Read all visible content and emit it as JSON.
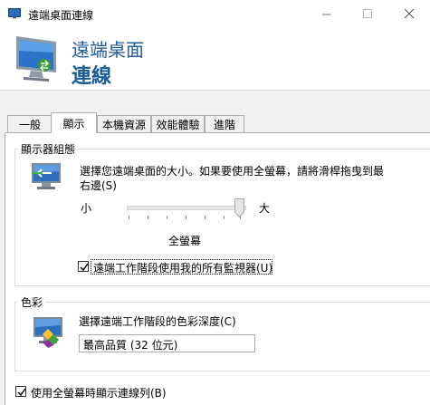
{
  "window": {
    "title": "遠端桌面連線"
  },
  "header": {
    "line1": "遠端桌面",
    "line2": "連線"
  },
  "tabs": [
    {
      "label": "一般",
      "active": false
    },
    {
      "label": "顯示",
      "active": true
    },
    {
      "label": "本機資源",
      "active": false
    },
    {
      "label": "效能體驗",
      "active": false
    },
    {
      "label": "進階",
      "active": false
    }
  ],
  "display_config": {
    "group_label": "顯示器組態",
    "description_line1": "選擇您遠端桌面的大小。如果要使用全螢幕，請將滑桿拖曳到最",
    "description_line2": "右邊(S)",
    "slider_min_label": "小",
    "slider_max_label": "大",
    "slider_value": 1.0,
    "current_size_label": "全螢幕",
    "all_monitors_label": "遠端工作階段使用我的所有監視器(U)",
    "all_monitors_checked": true
  },
  "colors": {
    "group_label": "色彩",
    "prompt": "選擇遠端工作階段的色彩深度(C)",
    "selected_depth": "最高品質 (32 位元)"
  },
  "fullscreen_bar": {
    "label": "使用全螢幕時顯示連線列(B)",
    "checked": true
  },
  "accent_color": "#1c5b9a"
}
